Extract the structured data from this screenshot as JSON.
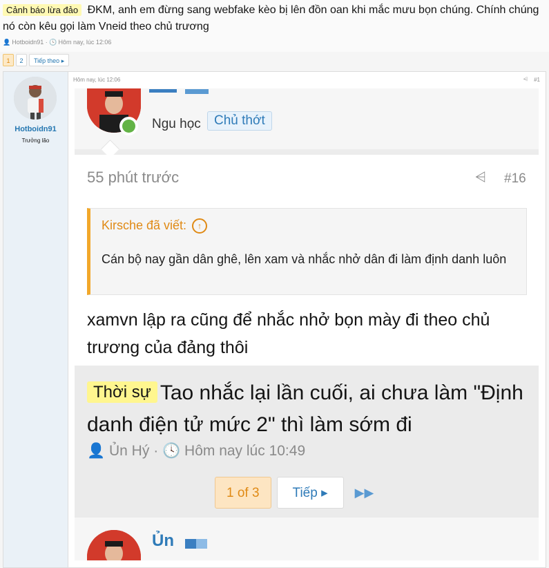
{
  "thread": {
    "prefix": "Cảnh báo lừa đảo",
    "title": "ĐKM, anh em đừng sang webfake kèo bị lên đồn oan khi mắc mưu bọn chúng. Chính chúng nó còn kêu gọi làm Vneid theo chủ trương",
    "author": "Hotboidn91",
    "time": "Hôm nay, lúc 12:06",
    "icons": {
      "author": "user-icon",
      "time": "clock-icon"
    }
  },
  "pagenav": {
    "pages": [
      "1",
      "2"
    ],
    "current": "1",
    "next_label": "Tiếp theo ▸"
  },
  "post": {
    "username": "Hotboidn91",
    "user_title": "Trưởng lão",
    "time": "Hôm nay, lúc 12:06",
    "number": "#1",
    "share_icon": "share-icon",
    "screenshot": {
      "top_user": "Ngu học",
      "top_tag": "Chủ thớt",
      "time": "55 phút trước",
      "number": "#16",
      "quote_author": "Kirsche đã viết:",
      "quote_text": "Cán bộ nay gần dân ghê, lên xam và nhắc nhở dân đi làm định danh luôn",
      "reply": "xamvn lập ra cũng để nhắc nhở bọn mày đi theo chủ trương của đảng thôi",
      "thread_prefix": "Thời sự",
      "thread_title": "Tao nhắc lại lần cuối, ai chưa làm \"Định danh điện tử mức 2\" thì làm sớm đi",
      "thread_author": "Ủn Hý",
      "thread_time": "Hôm nay lúc 10:49",
      "page_label": "1 of 3",
      "next_label": "Tiếp ▸",
      "bottom_user": "Ủn",
      "colors": {
        "quote_accent": "#f2a82a",
        "link": "#2f7bb8",
        "online": "#63b346"
      }
    }
  }
}
